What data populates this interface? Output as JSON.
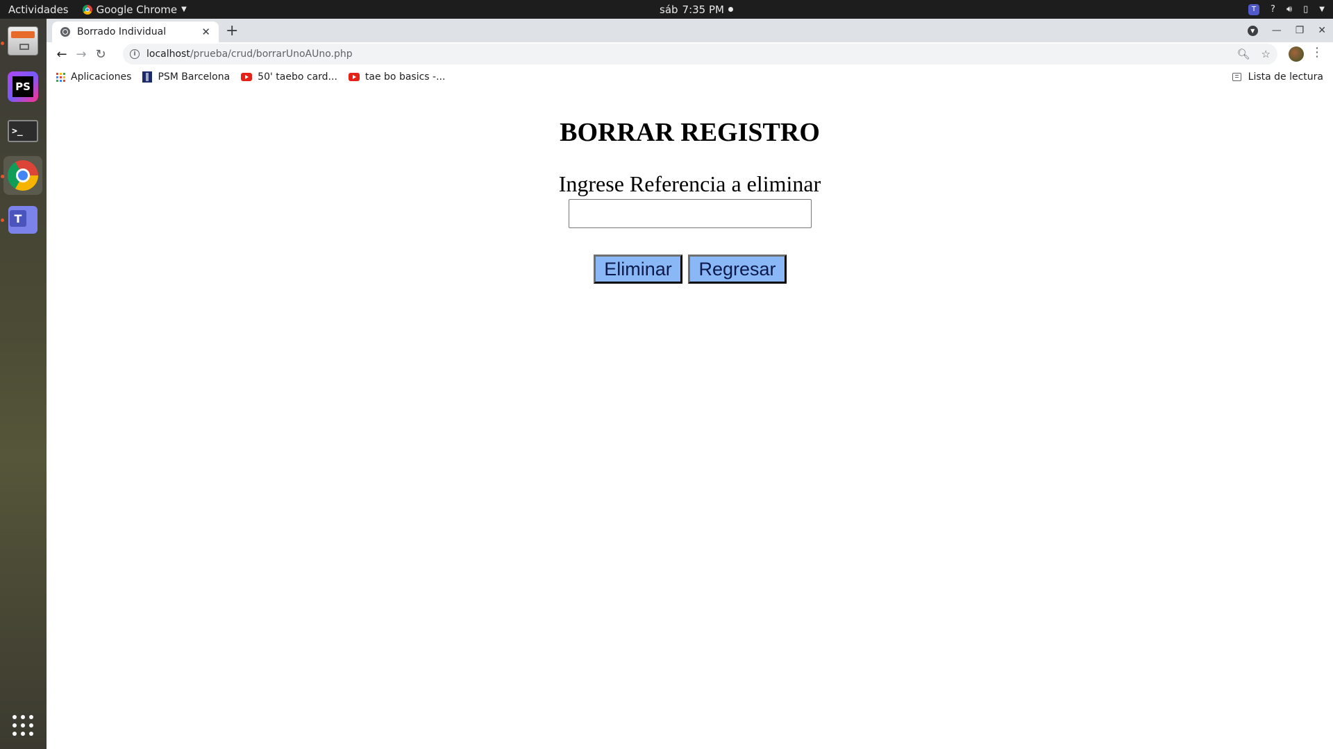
{
  "topbar": {
    "activities": "Actividades",
    "app_name": "Google Chrome",
    "day": "sáb",
    "time": "7:35 PM",
    "tray_help": "?"
  },
  "dock": {
    "items": [
      "files",
      "phpstorm",
      "terminal",
      "chrome",
      "teams",
      "show-applications"
    ],
    "phpstorm_label": "PS",
    "terminal_glyph": ">_",
    "teams_label": "T"
  },
  "browser": {
    "tab_title": "Borrado Individual",
    "url_host": "localhost",
    "url_path": "/prueba/crud/borrarUnoAUno.php",
    "bookmarks": [
      {
        "label": "Aplicaciones",
        "icon": "apps-grid-icon"
      },
      {
        "label": "PSM Barcelona",
        "icon": "psm-icon"
      },
      {
        "label": "50' taebo card...",
        "icon": "youtube-icon"
      },
      {
        "label": "tae bo basics -...",
        "icon": "youtube-icon"
      }
    ],
    "reading_list": "Lista de lectura"
  },
  "page": {
    "heading": "BORRAR REGISTRO",
    "prompt": "Ingrese Referencia a eliminar",
    "input_value": "",
    "delete_label": "Eliminar",
    "back_label": "Regresar"
  },
  "colors": {
    "button_bg": "#8ab8f7",
    "tabstrip_bg": "#dee1e6",
    "topbar_bg": "#1d1d1d"
  }
}
